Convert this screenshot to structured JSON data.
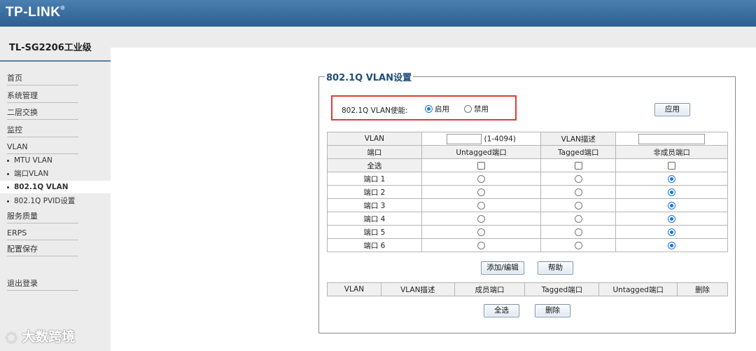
{
  "brand": {
    "logo": "TP-LINK",
    "mark": "®"
  },
  "model": "TL-SG2206工业级",
  "nav": [
    {
      "label": "首页"
    },
    {
      "label": "系统管理"
    },
    {
      "label": "二层交换"
    },
    {
      "label": "监控"
    },
    {
      "label": "VLAN"
    }
  ],
  "vlan_sub": [
    {
      "label": "MTU VLAN",
      "active": false
    },
    {
      "label": "端口VLAN",
      "active": false
    },
    {
      "label": "802.1Q VLAN",
      "active": true
    },
    {
      "label": "802.1Q PVID设置",
      "active": false
    }
  ],
  "nav2": [
    {
      "label": "服务质量"
    },
    {
      "label": "ERPS"
    },
    {
      "label": "配置保存"
    }
  ],
  "logout": "退出登录",
  "watermark": "大数跨境",
  "panel": {
    "title": "802.1Q VLAN设置",
    "enable_label": "802.1Q VLAN使能:",
    "enable_on": "启用",
    "enable_off": "禁用",
    "enabled": true,
    "apply": "应用"
  },
  "config_table": {
    "vlan_label": "VLAN",
    "vlan_value": "",
    "vlan_range": "(1-4094)",
    "desc_label": "VLAN描述",
    "desc_value": "",
    "col_port": "端口",
    "col_untagged": "Untagged端口",
    "col_tagged": "Tagged端口",
    "col_nonmember": "非成员端口",
    "select_all": "全选",
    "ports": [
      {
        "label": "端口 1",
        "mode": "nonmember"
      },
      {
        "label": "端口 2",
        "mode": "nonmember"
      },
      {
        "label": "端口 3",
        "mode": "nonmember"
      },
      {
        "label": "端口 4",
        "mode": "nonmember"
      },
      {
        "label": "端口 5",
        "mode": "nonmember"
      },
      {
        "label": "端口 6",
        "mode": "nonmember"
      }
    ]
  },
  "actions": {
    "add_edit": "添加/编辑",
    "help": "帮助"
  },
  "list_table": {
    "headers": [
      "VLAN",
      "VLAN描述",
      "成员端口",
      "Tagged端口",
      "Untagged端口",
      "删除"
    ]
  },
  "bottom": {
    "select_all": "全选",
    "delete": "删除"
  }
}
